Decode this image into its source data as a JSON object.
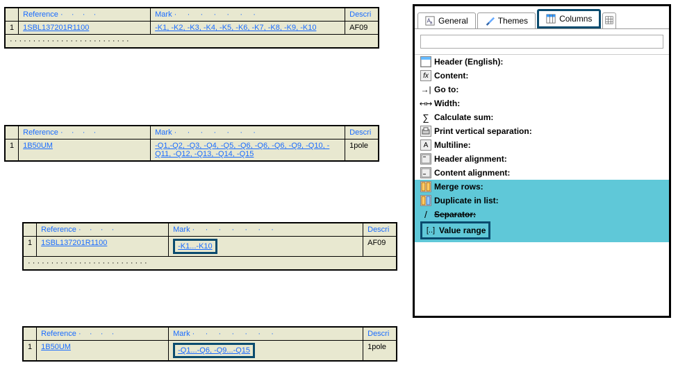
{
  "tables": {
    "top1": {
      "rownum": "1",
      "headers": {
        "ref": "Reference",
        "mark": "Mark",
        "desc": "Descri"
      },
      "ref": "1SBL137201R1100",
      "mark": "-K1, -K2, -K3, -K4, -K5, -K6, -K7, -K8, -K9, -K10",
      "desc": "AF09"
    },
    "top2": {
      "rownum": "1",
      "headers": {
        "ref": "Reference",
        "mark": "Mark",
        "desc": "Descri"
      },
      "ref": "1B50UM",
      "mark": "-Q1,-Q2, -Q3, -Q4, -Q5, -Q6, -Q6, -Q6, -Q9, -Q10, -Q11, -Q12, -Q13, -Q14, -Q15",
      "desc": "1pole"
    },
    "bot1": {
      "rownum": "1",
      "headers": {
        "ref": "Reference",
        "mark": "Mark",
        "desc": "Descri"
      },
      "ref": "1SBL137201R1100",
      "mark": "-K1...-K10",
      "desc": "AF09"
    },
    "bot2": {
      "rownum": "1",
      "headers": {
        "ref": "Reference",
        "mark": "Mark",
        "desc": "Descri"
      },
      "ref": "1B50UM",
      "mark": "-Q1...-Q6, -Q9...-Q15",
      "desc": "1pole"
    }
  },
  "panel": {
    "tabs": {
      "general": "General",
      "themes": "Themes",
      "columns": "Columns"
    },
    "props": {
      "header": "Header (English):",
      "content": "Content:",
      "goto": "Go to:",
      "width": "Width:",
      "sum": "Calculate sum:",
      "printsep": "Print vertical separation:",
      "multiline": "Multiline:",
      "halign": "Header alignment:",
      "calign": "Content alignment:",
      "merge": "Merge rows:",
      "duplist": "Duplicate in list:",
      "separator": "Separator:",
      "vrange": "Value range"
    }
  }
}
